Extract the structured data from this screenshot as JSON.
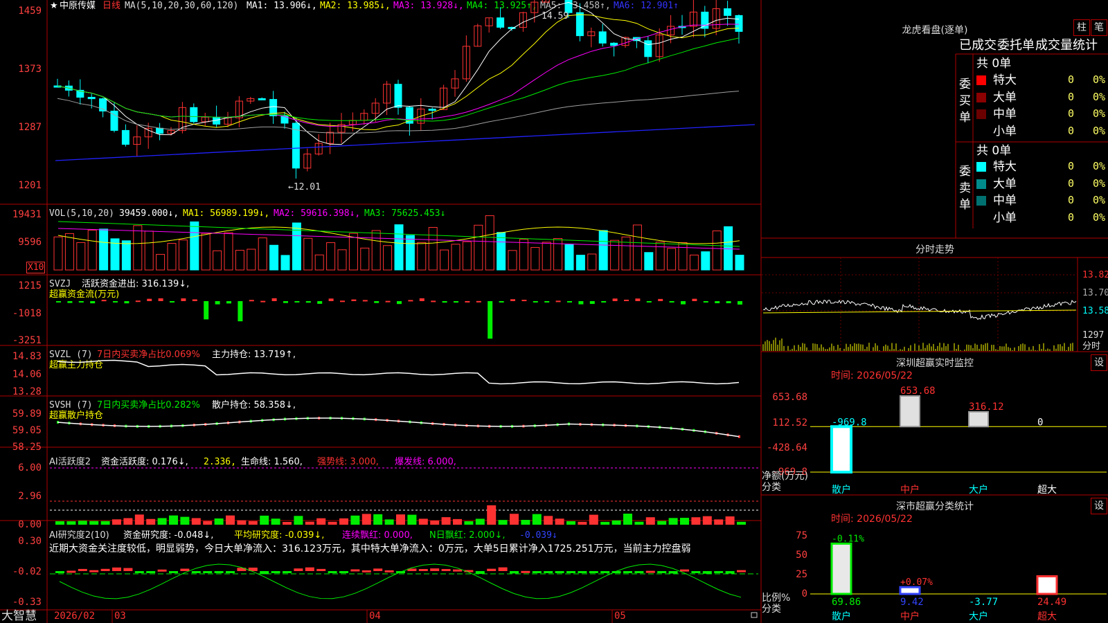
{
  "colors": {
    "up": "#ff3232",
    "down": "#00ffff",
    "green": "#00ee00",
    "frame": "#b00000",
    "white": "#ffffff",
    "yellow": "#ffff00",
    "magenta": "#ff00ff",
    "blue": "#2222ff",
    "grey": "#a0a0a0"
  },
  "stock": {
    "star": "★",
    "name": "中原传媒",
    "period": "日线"
  },
  "main_legend": {
    "ma": "MA(5,10,20,30,60,120)",
    "ma1": "MA1: 13.906↓,",
    "ma2": "MA2: 13.985↓,",
    "ma3": "MA3: 13.928↓,",
    "ma4": "MA4: 13.925↑,",
    "ma5": "MA5: 13.458↑,",
    "ma6": "MA6: 12.901↑"
  },
  "main_axis": [
    "1459",
    "1373",
    "1287",
    "1201"
  ],
  "main_marks": {
    "high": "14.59",
    "low": "←12.01"
  },
  "vol_legend": {
    "name": "VOL(5,10,20)",
    "val": "39459.000↓,",
    "ma1": "MA1: 56989.199↓,",
    "ma2": "MA2: 59616.398↓,",
    "ma3": "MA3: 75625.453↓"
  },
  "vol_axis": [
    "19431",
    "9596"
  ],
  "vol_unit": "X10",
  "svzj": {
    "name": "SVZJ",
    "label": "活跃资金进出: 316.139↓,",
    "sub": "超赢资金流(万元)",
    "axis": [
      "1215",
      "-1018",
      "-3251"
    ]
  },
  "svzl": {
    "name": "SVZL (7)",
    "label1": "7日内买卖净占比0.069%",
    "label2": "主力持仓: 13.719↑,",
    "sub": "超赢主力持仓",
    "axis": [
      "14.83",
      "14.06",
      "13.28"
    ]
  },
  "svsh": {
    "name": "SVSH (7)",
    "label1": "7日内买卖净占比0.282%",
    "label2": "散户持仓: 58.358↓,",
    "sub": "超赢散户持仓",
    "axis": [
      "59.89",
      "59.05",
      "58.25"
    ]
  },
  "ai1": {
    "name": "AI活跃度2",
    "l1": "资金活跃度: 0.176↓,",
    "l2": "2.336,",
    "l3": "生命线: 1.560,",
    "l4": "强势线: 3.000,",
    "l5": "爆发线: 6.000,",
    "axis": [
      "6.00",
      "2.96",
      "0.00"
    ]
  },
  "ai2": {
    "name": "AI研究度2(10)",
    "l1": "资金研究度: -0.048↓,",
    "l2": "平均研究度: -0.039↓,",
    "l3": "连续飘红: 0.000,",
    "l4": "N日飘红: 2.000↓,",
    "l5": "-0.039↓",
    "comment": "近期大资金关注度较低，明显弱势，今日大单净流入：316.123万元，其中特大单净流入：0万元，大单5日累计净入1725.251万元，当前主力控盘弱",
    "axis": [
      "0.30",
      "-0.02",
      "-0.33"
    ]
  },
  "bottom": {
    "brand": "大智慧",
    "dates": [
      "2026/02",
      "03",
      "04",
      "05"
    ]
  },
  "longhu": {
    "title": "龙虎看盘(逐单)",
    "btn1": "柱",
    "btn2": "笔",
    "tabs": [
      "已成交",
      "委托单",
      "成交量统计"
    ],
    "buy": {
      "side": "委买单",
      "total": "共 0单",
      "rows": [
        {
          "name": "特大",
          "v": "0",
          "p": "0%",
          "c": "#ff0000"
        },
        {
          "name": "大单",
          "v": "0",
          "p": "0%",
          "c": "#8b0000"
        },
        {
          "name": "中单",
          "v": "0",
          "p": "0%",
          "c": "#6b0000"
        },
        {
          "name": "小单",
          "v": "0",
          "p": "0%",
          "c": ""
        }
      ]
    },
    "sell": {
      "side": "委卖单",
      "total": "共 0单",
      "rows": [
        {
          "name": "特大",
          "v": "0",
          "p": "0%",
          "c": "#00ffff"
        },
        {
          "name": "大单",
          "v": "0",
          "p": "0%",
          "c": "#008b8b"
        },
        {
          "name": "中单",
          "v": "0",
          "p": "0%",
          "c": "#007070"
        },
        {
          "name": "小单",
          "v": "0",
          "p": "0%",
          "c": ""
        }
      ]
    }
  },
  "fenshi": {
    "title": "分时走势",
    "axis": [
      "13.82",
      "13.70",
      "13.58"
    ],
    "vol": "1297",
    "unit": "分时"
  },
  "sz_monitor": {
    "title": "深圳超赢实时监控",
    "btn": "设",
    "time": "时间: 2026/05/22",
    "axis": [
      "653.68",
      "112.52",
      "-428.64",
      "-969.8"
    ],
    "ylabel": "净额(万元)",
    "xlabel": "分类",
    "chart_data": {
      "type": "bar",
      "categories": [
        "散户",
        "中户",
        "大户",
        "超大"
      ],
      "values": [
        -969.8,
        653.68,
        316.12,
        0
      ],
      "labels": [
        "-969.8",
        "653.68",
        "316.12",
        "0"
      ],
      "ylim": [
        -969.8,
        653.68
      ]
    }
  },
  "sz_class": {
    "title": "深市超赢分类统计",
    "btn": "设",
    "time": "时间: 2026/05/22",
    "axis": [
      "75",
      "50",
      "25",
      "0"
    ],
    "ylabel": "比例%",
    "xlabel": "分类",
    "chart_data": {
      "type": "bar",
      "categories": [
        "散户",
        "中户",
        "大户",
        "超大"
      ],
      "values": [
        69.86,
        9.42,
        -3.77,
        24.49
      ],
      "changes": [
        "-0.11%",
        "+0.07%",
        "",
        ""
      ],
      "ylim": [
        0,
        75
      ]
    }
  }
}
